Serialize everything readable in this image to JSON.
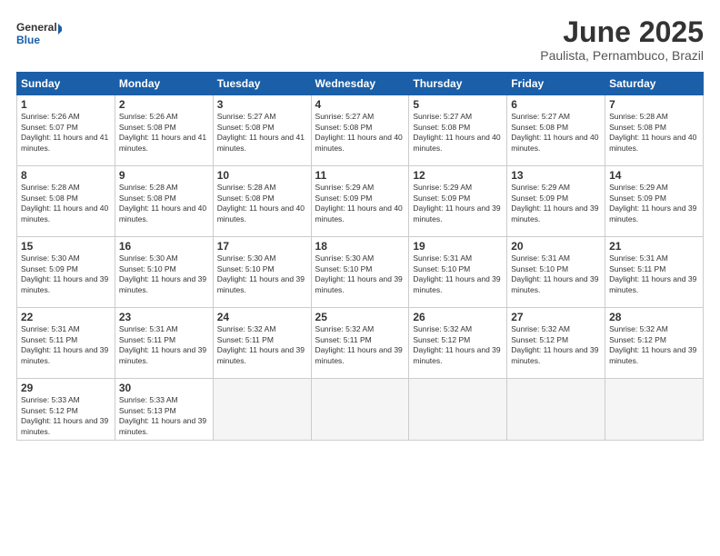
{
  "header": {
    "logo_general": "General",
    "logo_blue": "Blue",
    "title": "June 2025",
    "subtitle": "Paulista, Pernambuco, Brazil"
  },
  "calendar": {
    "days_of_week": [
      "Sunday",
      "Monday",
      "Tuesday",
      "Wednesday",
      "Thursday",
      "Friday",
      "Saturday"
    ],
    "weeks": [
      [
        {
          "day": "",
          "empty": true
        },
        {
          "day": "",
          "empty": true
        },
        {
          "day": "",
          "empty": true
        },
        {
          "day": "",
          "empty": true
        },
        {
          "day": "",
          "empty": true
        },
        {
          "day": "",
          "empty": true
        },
        {
          "day": "",
          "empty": true
        }
      ],
      [
        {
          "day": "1",
          "sunrise": "5:26 AM",
          "sunset": "5:07 PM",
          "daylight": "11 hours and 41 minutes."
        },
        {
          "day": "2",
          "sunrise": "5:26 AM",
          "sunset": "5:08 PM",
          "daylight": "11 hours and 41 minutes."
        },
        {
          "day": "3",
          "sunrise": "5:27 AM",
          "sunset": "5:08 PM",
          "daylight": "11 hours and 41 minutes."
        },
        {
          "day": "4",
          "sunrise": "5:27 AM",
          "sunset": "5:08 PM",
          "daylight": "11 hours and 40 minutes."
        },
        {
          "day": "5",
          "sunrise": "5:27 AM",
          "sunset": "5:08 PM",
          "daylight": "11 hours and 40 minutes."
        },
        {
          "day": "6",
          "sunrise": "5:27 AM",
          "sunset": "5:08 PM",
          "daylight": "11 hours and 40 minutes."
        },
        {
          "day": "7",
          "sunrise": "5:28 AM",
          "sunset": "5:08 PM",
          "daylight": "11 hours and 40 minutes."
        }
      ],
      [
        {
          "day": "8",
          "sunrise": "5:28 AM",
          "sunset": "5:08 PM",
          "daylight": "11 hours and 40 minutes."
        },
        {
          "day": "9",
          "sunrise": "5:28 AM",
          "sunset": "5:08 PM",
          "daylight": "11 hours and 40 minutes."
        },
        {
          "day": "10",
          "sunrise": "5:28 AM",
          "sunset": "5:08 PM",
          "daylight": "11 hours and 40 minutes."
        },
        {
          "day": "11",
          "sunrise": "5:29 AM",
          "sunset": "5:09 PM",
          "daylight": "11 hours and 40 minutes."
        },
        {
          "day": "12",
          "sunrise": "5:29 AM",
          "sunset": "5:09 PM",
          "daylight": "11 hours and 39 minutes."
        },
        {
          "day": "13",
          "sunrise": "5:29 AM",
          "sunset": "5:09 PM",
          "daylight": "11 hours and 39 minutes."
        },
        {
          "day": "14",
          "sunrise": "5:29 AM",
          "sunset": "5:09 PM",
          "daylight": "11 hours and 39 minutes."
        }
      ],
      [
        {
          "day": "15",
          "sunrise": "5:30 AM",
          "sunset": "5:09 PM",
          "daylight": "11 hours and 39 minutes."
        },
        {
          "day": "16",
          "sunrise": "5:30 AM",
          "sunset": "5:10 PM",
          "daylight": "11 hours and 39 minutes."
        },
        {
          "day": "17",
          "sunrise": "5:30 AM",
          "sunset": "5:10 PM",
          "daylight": "11 hours and 39 minutes."
        },
        {
          "day": "18",
          "sunrise": "5:30 AM",
          "sunset": "5:10 PM",
          "daylight": "11 hours and 39 minutes."
        },
        {
          "day": "19",
          "sunrise": "5:31 AM",
          "sunset": "5:10 PM",
          "daylight": "11 hours and 39 minutes."
        },
        {
          "day": "20",
          "sunrise": "5:31 AM",
          "sunset": "5:10 PM",
          "daylight": "11 hours and 39 minutes."
        },
        {
          "day": "21",
          "sunrise": "5:31 AM",
          "sunset": "5:11 PM",
          "daylight": "11 hours and 39 minutes."
        }
      ],
      [
        {
          "day": "22",
          "sunrise": "5:31 AM",
          "sunset": "5:11 PM",
          "daylight": "11 hours and 39 minutes."
        },
        {
          "day": "23",
          "sunrise": "5:31 AM",
          "sunset": "5:11 PM",
          "daylight": "11 hours and 39 minutes."
        },
        {
          "day": "24",
          "sunrise": "5:32 AM",
          "sunset": "5:11 PM",
          "daylight": "11 hours and 39 minutes."
        },
        {
          "day": "25",
          "sunrise": "5:32 AM",
          "sunset": "5:11 PM",
          "daylight": "11 hours and 39 minutes."
        },
        {
          "day": "26",
          "sunrise": "5:32 AM",
          "sunset": "5:12 PM",
          "daylight": "11 hours and 39 minutes."
        },
        {
          "day": "27",
          "sunrise": "5:32 AM",
          "sunset": "5:12 PM",
          "daylight": "11 hours and 39 minutes."
        },
        {
          "day": "28",
          "sunrise": "5:32 AM",
          "sunset": "5:12 PM",
          "daylight": "11 hours and 39 minutes."
        }
      ],
      [
        {
          "day": "29",
          "sunrise": "5:33 AM",
          "sunset": "5:12 PM",
          "daylight": "11 hours and 39 minutes."
        },
        {
          "day": "30",
          "sunrise": "5:33 AM",
          "sunset": "5:13 PM",
          "daylight": "11 hours and 39 minutes."
        },
        {
          "day": "",
          "empty": true
        },
        {
          "day": "",
          "empty": true
        },
        {
          "day": "",
          "empty": true
        },
        {
          "day": "",
          "empty": true
        },
        {
          "day": "",
          "empty": true
        }
      ]
    ]
  }
}
